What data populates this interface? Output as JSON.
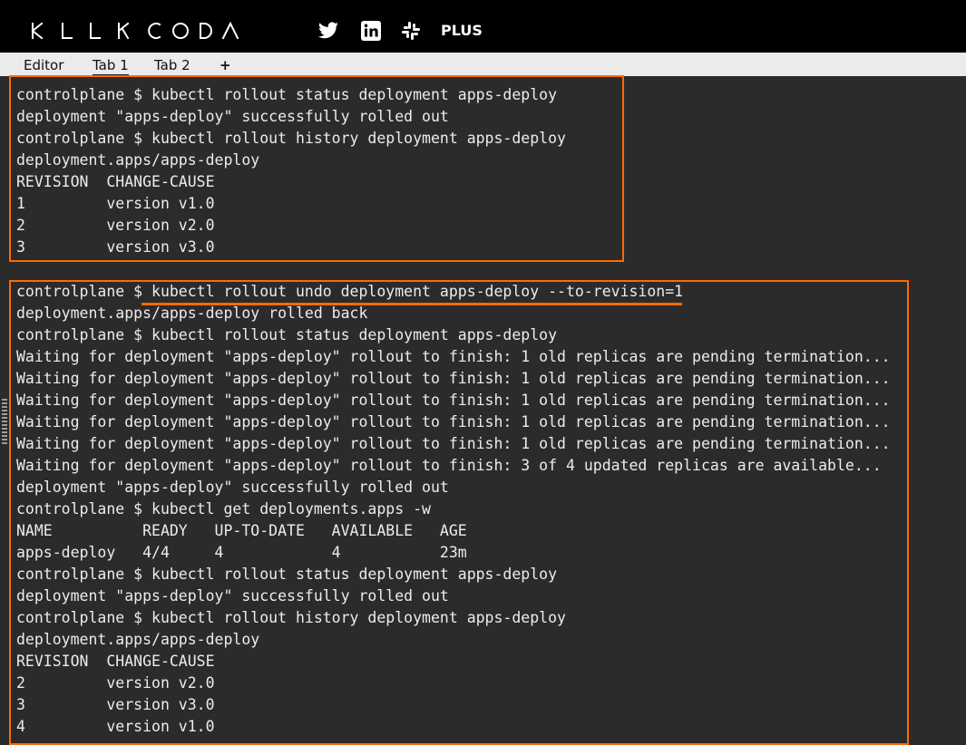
{
  "header": {
    "logo": "KLLKCODA",
    "social": [
      "twitter-icon",
      "linkedin-icon",
      "slack-icon"
    ],
    "plus_label": "PLUS"
  },
  "tabs": {
    "editor": "Editor",
    "tab1": "Tab 1",
    "tab2": "Tab 2",
    "add": "+"
  },
  "colors": {
    "header_bg": "#000000",
    "tabbar_bg": "#ebebeb",
    "terminal_bg": "#2b2b2b",
    "terminal_text": "#ececec",
    "highlight": "#ff6a00"
  },
  "terminal": {
    "block1": [
      "controlplane $ kubectl rollout status deployment apps-deploy",
      "deployment \"apps-deploy\" successfully rolled out",
      "controlplane $ kubectl rollout history deployment apps-deploy",
      "deployment.apps/apps-deploy",
      "REVISION  CHANGE-CAUSE",
      "1         version v1.0",
      "2         version v2.0",
      "3         version v3.0"
    ],
    "block2": [
      "controlplane $ kubectl rollout undo deployment apps-deploy --to-revision=1",
      "deployment.apps/apps-deploy rolled back",
      "controlplane $ kubectl rollout status deployment apps-deploy",
      "Waiting for deployment \"apps-deploy\" rollout to finish: 1 old replicas are pending termination...",
      "Waiting for deployment \"apps-deploy\" rollout to finish: 1 old replicas are pending termination...",
      "Waiting for deployment \"apps-deploy\" rollout to finish: 1 old replicas are pending termination...",
      "Waiting for deployment \"apps-deploy\" rollout to finish: 1 old replicas are pending termination...",
      "Waiting for deployment \"apps-deploy\" rollout to finish: 1 old replicas are pending termination...",
      "Waiting for deployment \"apps-deploy\" rollout to finish: 3 of 4 updated replicas are available...",
      "deployment \"apps-deploy\" successfully rolled out",
      "controlplane $ kubectl get deployments.apps -w",
      "NAME          READY   UP-TO-DATE   AVAILABLE   AGE",
      "apps-deploy   4/4     4            4           23m",
      "controlplane $ kubectl rollout status deployment apps-deploy",
      "deployment \"apps-deploy\" successfully rolled out",
      "controlplane $ kubectl rollout history deployment apps-deploy",
      "deployment.apps/apps-deploy",
      "REVISION  CHANGE-CAUSE",
      "2         version v2.0",
      "3         version v3.0",
      "4         version v1.0"
    ]
  }
}
